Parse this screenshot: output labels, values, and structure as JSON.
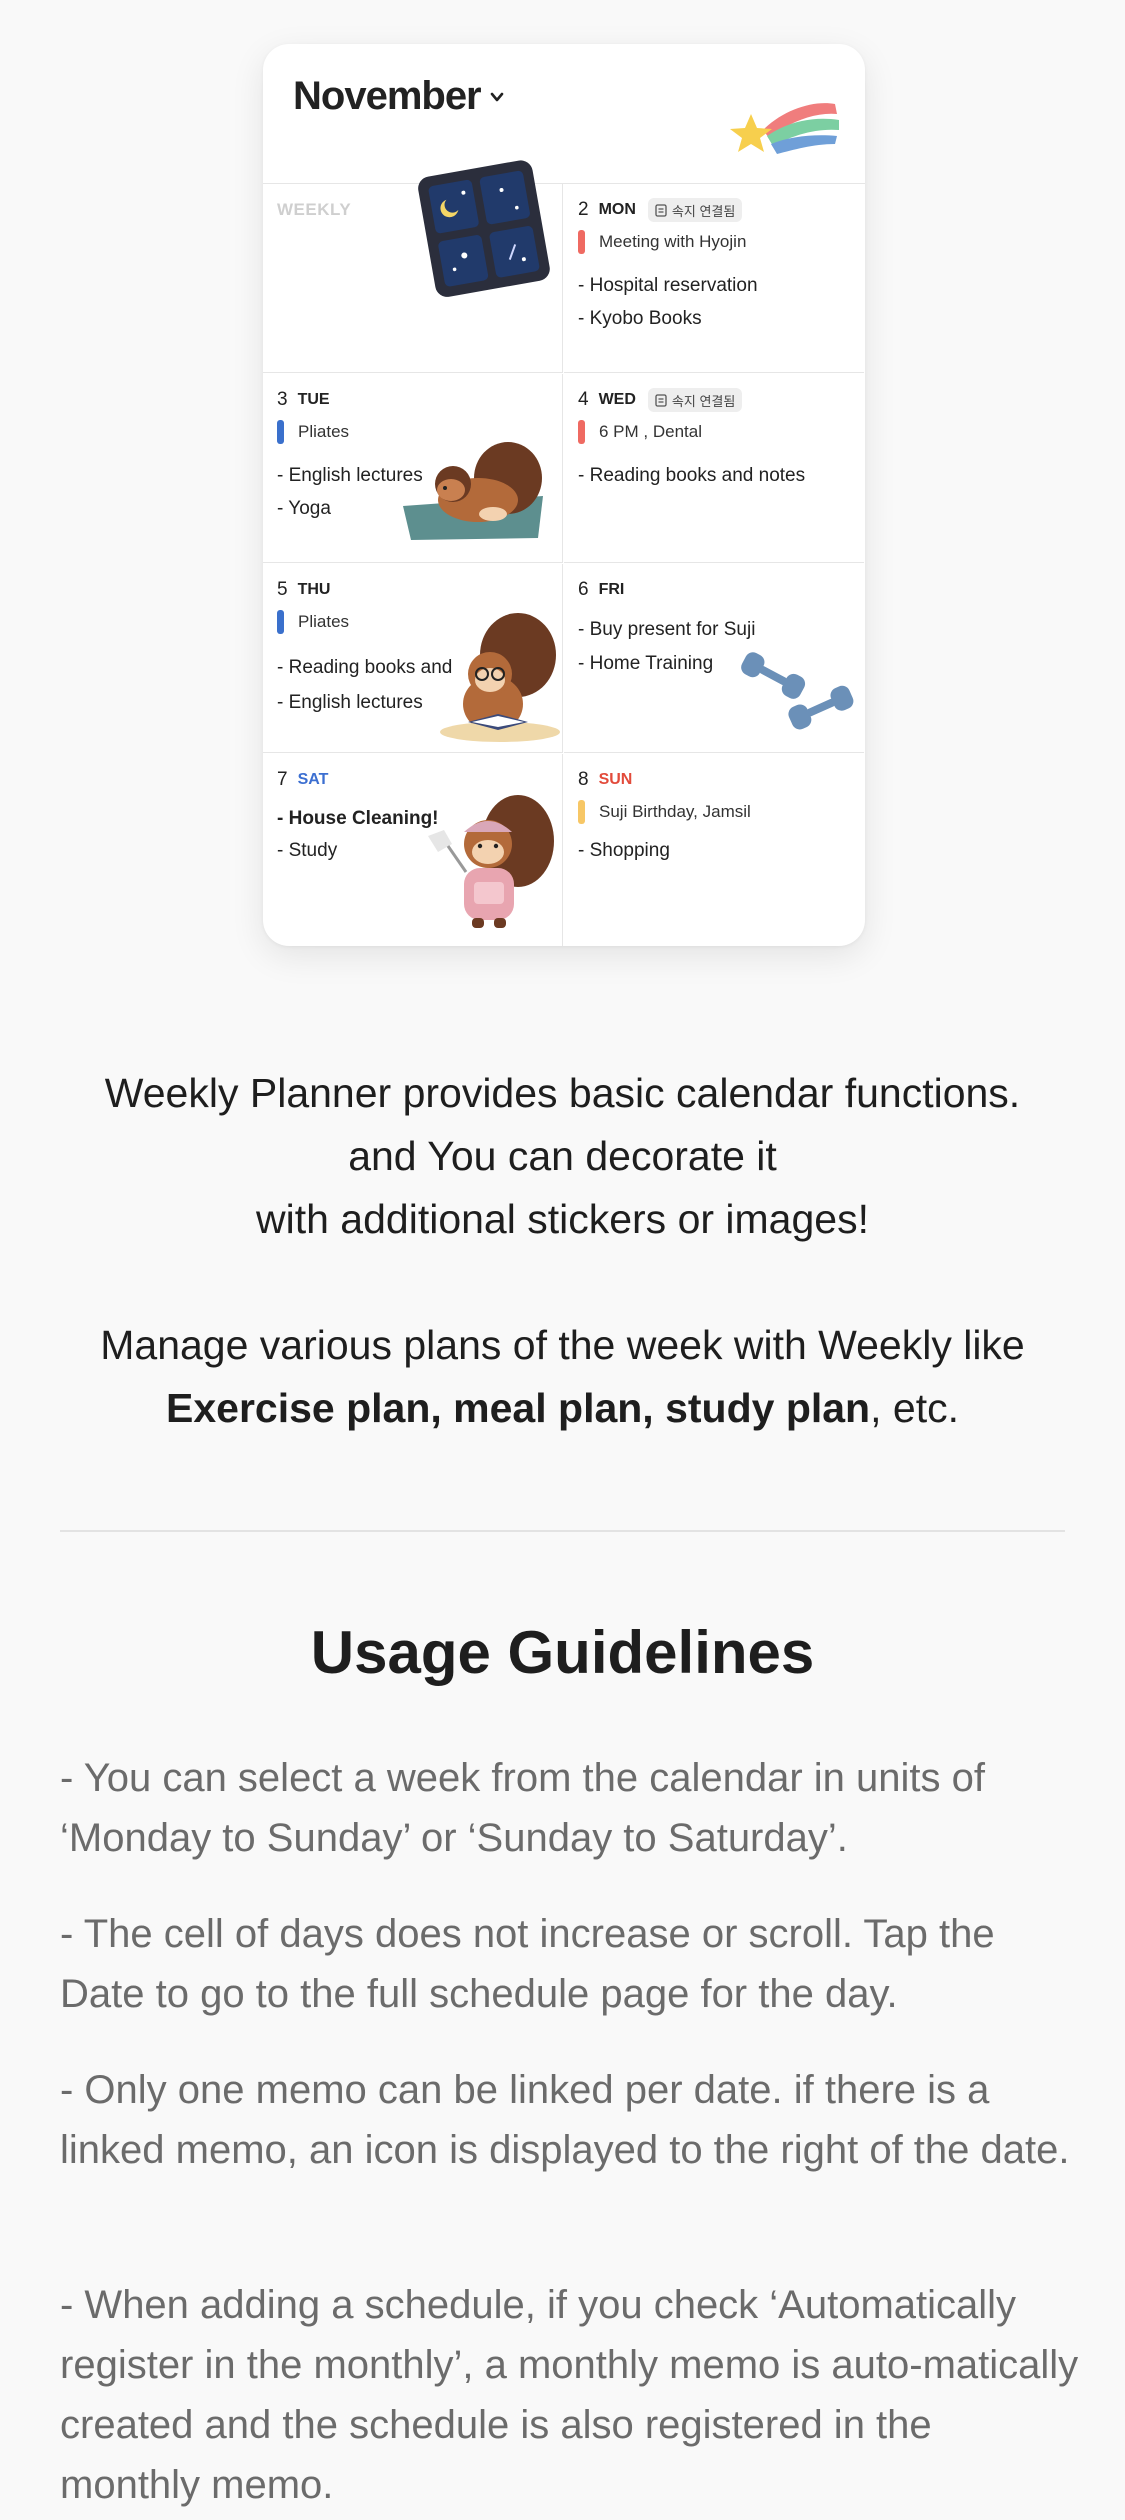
{
  "planner": {
    "month": "November",
    "weekly_label": "WEEKLY",
    "memo_badge_label": "속지 연결됨",
    "days": {
      "mon": {
        "num": "2",
        "name": "MON",
        "events": [
          "Meeting with Hyojin"
        ],
        "todos": [
          "- Hospital reservation",
          "- Kyobo Books"
        ]
      },
      "tue": {
        "num": "3",
        "name": "TUE",
        "events": [
          "Pliates"
        ],
        "todos": [
          "- English lectures",
          "- Yoga"
        ]
      },
      "wed": {
        "num": "4",
        "name": "WED",
        "events": [
          "6 PM , Dental"
        ],
        "todos": [
          "- Reading books and notes"
        ]
      },
      "thu": {
        "num": "5",
        "name": "THU",
        "events": [
          "Pliates"
        ],
        "todos": [
          "- Reading books and",
          "- English lectures"
        ]
      },
      "fri": {
        "num": "6",
        "name": "FRI",
        "todos": [
          "- Buy present for Suji",
          "- Home Training"
        ]
      },
      "sat": {
        "num": "7",
        "name": "SAT",
        "todos": [
          "- House Cleaning!",
          "- Study"
        ]
      },
      "sun": {
        "num": "8",
        "name": "SUN",
        "events": [
          "Suji Birthday, Jamsil"
        ],
        "todos": [
          "- Shopping"
        ]
      }
    },
    "colors": {
      "red_tag": "#ef6a62",
      "blue_tag": "#3a70cc",
      "yellow_tag": "#f7c766",
      "sat": "#3c6fd1",
      "sun": "#e24b3b"
    }
  },
  "description": {
    "line1": "Weekly Planner provides basic calendar functions.",
    "line2": "and You can decorate it",
    "line3": "with additional stickers or images!",
    "line4": "Manage various plans of the week with Weekly like",
    "line5_bold": "Exercise plan, meal plan, study plan",
    "line5_rest": ", etc."
  },
  "guidelines": {
    "title": "Usage Guidelines",
    "items": [
      "- You can select a week from the calendar in units of ‘Monday to Sunday’ or ‘Sunday to Saturday’.",
      "- The cell of days does not increase or scroll. Tap the Date to go to the full schedule page for the day.",
      "- Only one memo can be linked per date. if there is a linked memo, an icon is displayed to the right of the date.",
      "- When adding a schedule, if you check ‘Automatically register in the monthly’, a monthly memo is auto-matically created and the schedule is also registered in the monthly memo."
    ]
  }
}
